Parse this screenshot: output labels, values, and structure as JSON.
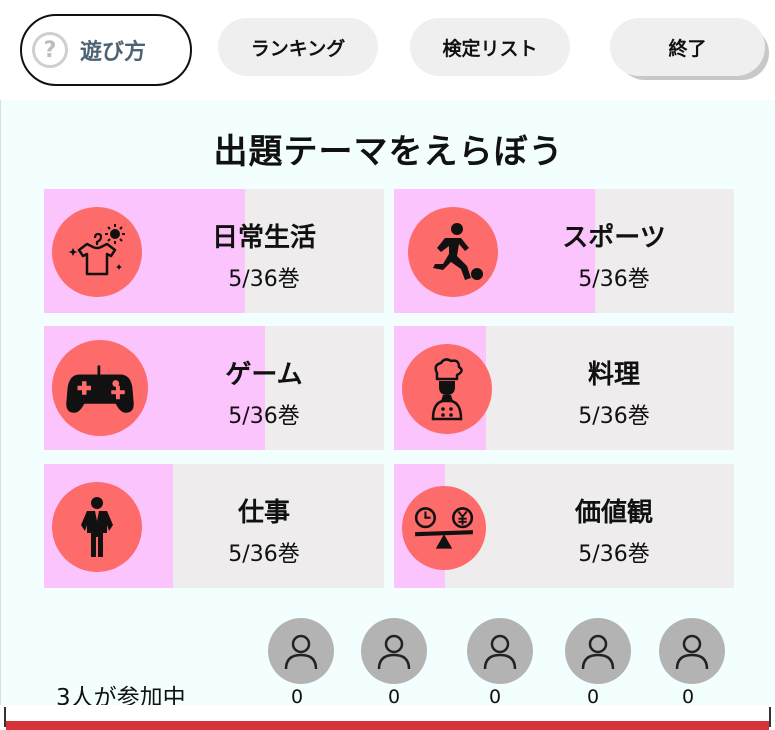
{
  "header": {
    "help_label": "遊び方",
    "help_glyph": "?",
    "ranking_label": "ランキング",
    "list_label": "検定リスト",
    "end_label": "終了"
  },
  "main": {
    "title": "出題テーマをえらぼう",
    "themes": [
      {
        "name": "日常生活",
        "count": "5/36巻",
        "icon": "laundry-sun-icon",
        "progress": 0.59
      },
      {
        "name": "スポーツ",
        "count": "5/36巻",
        "icon": "soccer-player-icon",
        "progress": 0.59
      },
      {
        "name": "ゲーム",
        "count": "5/36巻",
        "icon": "gamepad-icon",
        "progress": 0.65
      },
      {
        "name": "料理",
        "count": "5/36巻",
        "icon": "chef-icon",
        "progress": 0.27
      },
      {
        "name": "仕事",
        "count": "5/36巻",
        "icon": "businessman-icon",
        "progress": 0.38
      },
      {
        "name": "価値観",
        "count": "5/36巻",
        "icon": "scale-time-money-icon",
        "progress": 0.15
      }
    ]
  },
  "players": {
    "participants_text": "3人が参加中",
    "scores": [
      "0",
      "0",
      "0",
      "0",
      "0"
    ]
  },
  "colors": {
    "accent_pink": "#fcc4fc",
    "icon_red": "#fd6b6b",
    "card_gray": "#eeecec",
    "footer_red": "#d6323a"
  }
}
